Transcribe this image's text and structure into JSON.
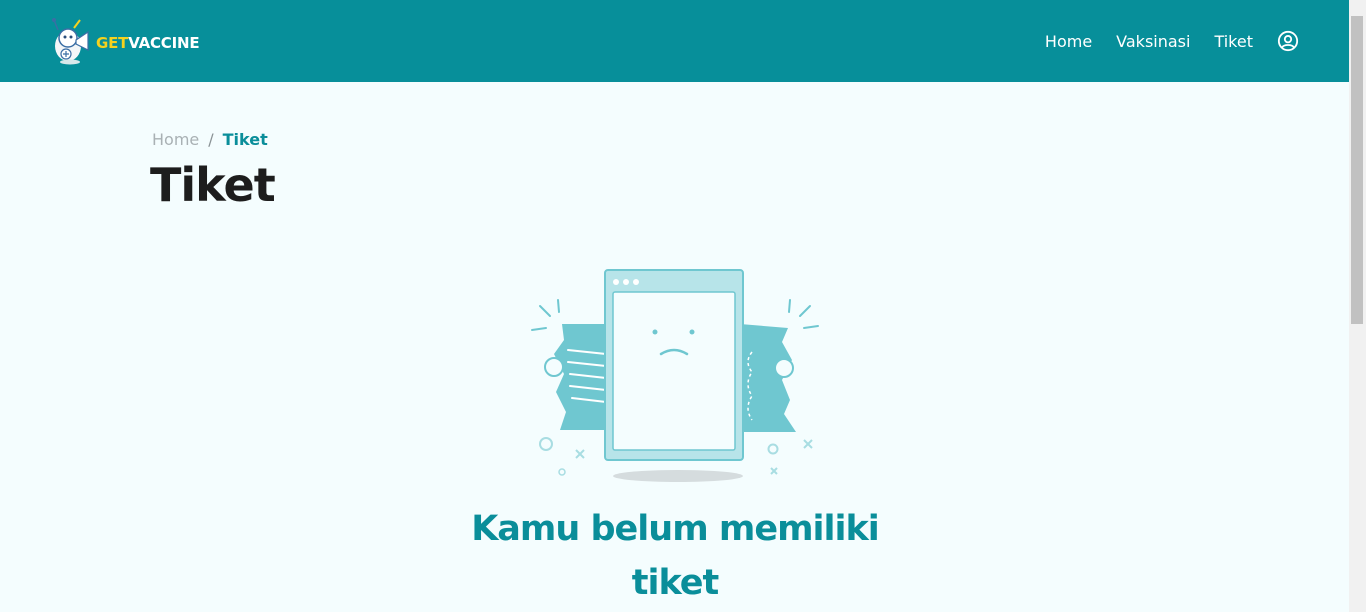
{
  "brand": {
    "logo_get": "GET",
    "logo_vaccine": "VACCINE",
    "logo_icon": "mascot-icon"
  },
  "nav": {
    "items": [
      {
        "label": "Home"
      },
      {
        "label": "Vaksinasi"
      },
      {
        "label": "Tiket"
      }
    ],
    "user_icon": "user-circle-icon"
  },
  "breadcrumb": {
    "home": "Home",
    "separator": "/",
    "current": "Tiket"
  },
  "page": {
    "title": "Tiket",
    "empty_message": "Kamu belum memiliki tiket",
    "illustration_icon": "empty-ticket-illustration"
  },
  "colors": {
    "primary": "#078f9a",
    "accent_yellow": "#f5d21e",
    "background": "#f4fdfe",
    "illustration": "#6fc7d0"
  }
}
